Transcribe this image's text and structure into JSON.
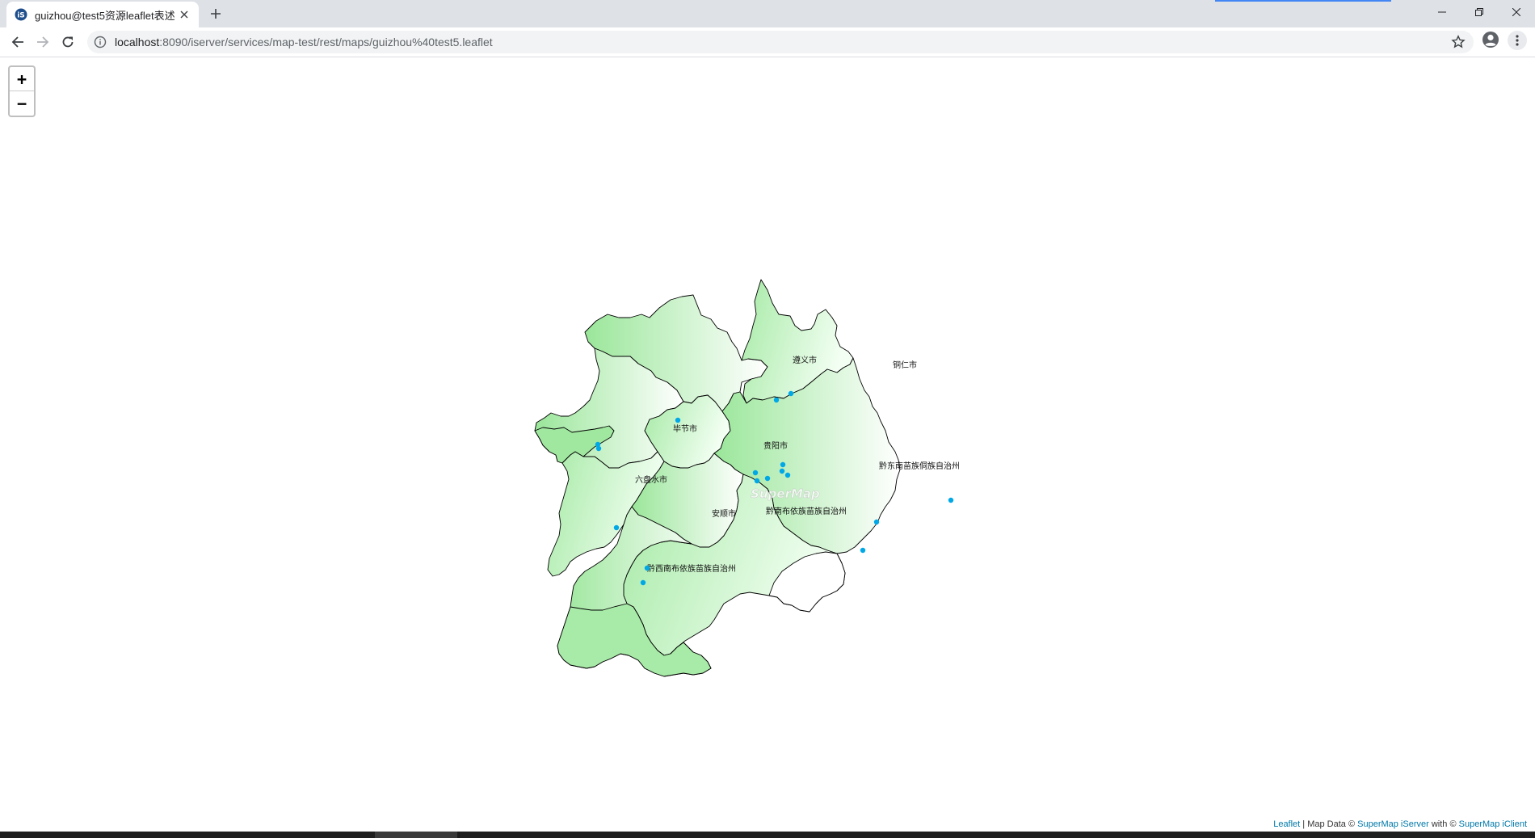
{
  "browser": {
    "tab_title": "guizhou@test5资源leaflet表述",
    "url_host": "localhost",
    "url_rest": ":8090/iserver/services/map-test/rest/maps/guizhou%40test5.leaflet"
  },
  "map": {
    "zoom_in_label": "+",
    "zoom_out_label": "−",
    "fill_gradient": [
      "#9ae69a",
      "#ffffff"
    ],
    "border_color": "#000000",
    "point_color": "#00a8e6",
    "watermark": "SuperMap",
    "regions": [
      {
        "name": "遵义市"
      },
      {
        "name": "铜仁市"
      },
      {
        "name": "毕节市"
      },
      {
        "name": "贵阳市"
      },
      {
        "name": "黔东南苗族侗族自治州"
      },
      {
        "name": "六盘水市"
      },
      {
        "name": "安顺市"
      },
      {
        "name": "黔南布依族苗族自治州"
      },
      {
        "name": "黔西南布依族苗族自治州"
      }
    ],
    "attribution": {
      "leaflet": "Leaflet",
      "sep": " | Map Data © ",
      "iserver": "SuperMap iServer",
      "with": " with © ",
      "iclient": "SuperMap iClient"
    }
  }
}
